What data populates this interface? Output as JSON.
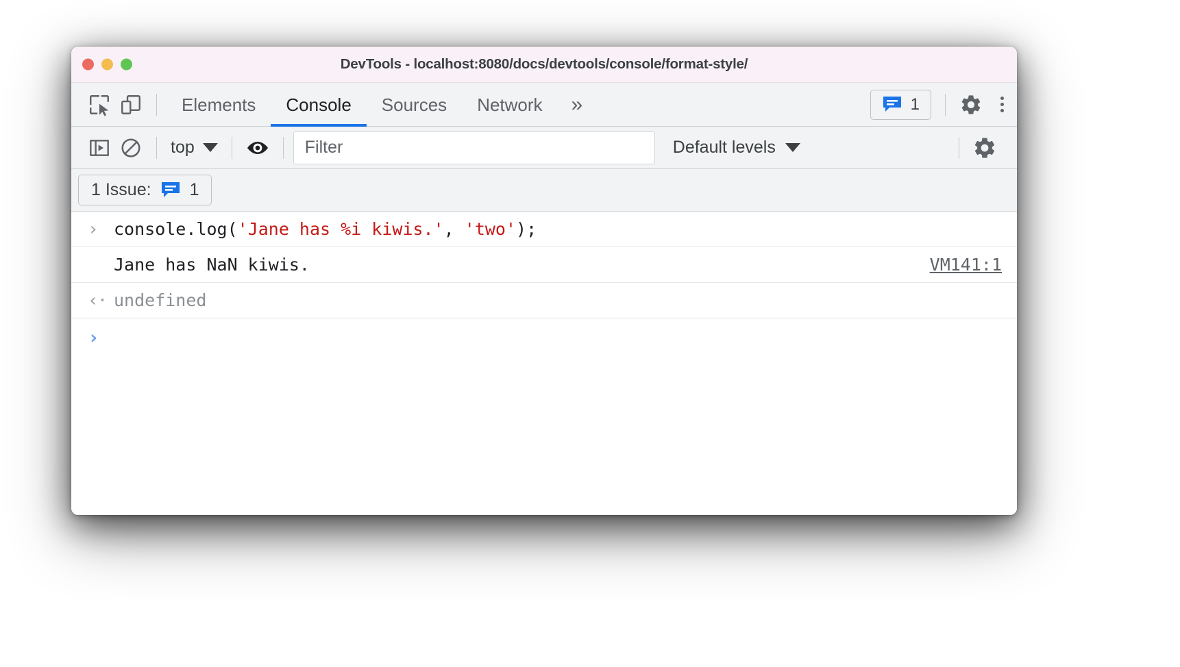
{
  "window": {
    "title": "DevTools - localhost:8080/docs/devtools/console/format-style/",
    "traffic_lights": [
      "close",
      "minimize",
      "maximize"
    ]
  },
  "tabstrip": {
    "icons": [
      {
        "name": "inspect-element-icon",
        "label": "Inspect element"
      },
      {
        "name": "device-toolbar-icon",
        "label": "Toggle device toolbar"
      }
    ],
    "tabs": [
      {
        "label": "Elements",
        "selected": false
      },
      {
        "label": "Console",
        "selected": true
      },
      {
        "label": "Sources",
        "selected": false
      },
      {
        "label": "Network",
        "selected": false
      }
    ],
    "more_tabs_label": "»",
    "issues_badge": {
      "icon": "message-icon",
      "count": "1"
    },
    "settings_icon": "gear-icon",
    "more_options_icon": "kebab-menu-icon"
  },
  "console_toolbar": {
    "sidebar_toggle_icon": "console-sidebar-icon",
    "clear_console_icon": "clear-console-icon",
    "context": {
      "value": "top",
      "caret": "▼"
    },
    "eye_icon": "live-expression-eye-icon",
    "filter": {
      "value": "",
      "placeholder": "Filter"
    },
    "levels": {
      "value": "Default levels",
      "caret": "▼"
    },
    "settings_icon": "console-settings-gear-icon"
  },
  "issues_bar": {
    "chip": {
      "text": "1 Issue:",
      "icon": "message-icon",
      "count": "1"
    }
  },
  "console": {
    "rows": [
      {
        "type": "input",
        "gutter": "›",
        "segments": [
          {
            "text": "console.log(",
            "kind": "code"
          },
          {
            "text": "'Jane has %i kiwis.'",
            "kind": "string"
          },
          {
            "text": ", ",
            "kind": "code"
          },
          {
            "text": "'two'",
            "kind": "string"
          },
          {
            "text": ");",
            "kind": "code"
          }
        ],
        "source": ""
      },
      {
        "type": "output",
        "gutter": "",
        "text": "Jane has NaN kiwis.",
        "source": "VM141:1"
      },
      {
        "type": "result",
        "gutter": "‹·",
        "text": "undefined",
        "source": ""
      },
      {
        "type": "prompt",
        "gutter": "›",
        "text": "",
        "source": ""
      }
    ]
  },
  "colors": {
    "accent_blue": "#1a73e8",
    "titlebar_bg": "#f9f1f7",
    "toolbar_bg": "#f1f3f4",
    "string_red": "#c41a16",
    "text_primary": "#202124",
    "text_secondary": "#5f6368"
  }
}
